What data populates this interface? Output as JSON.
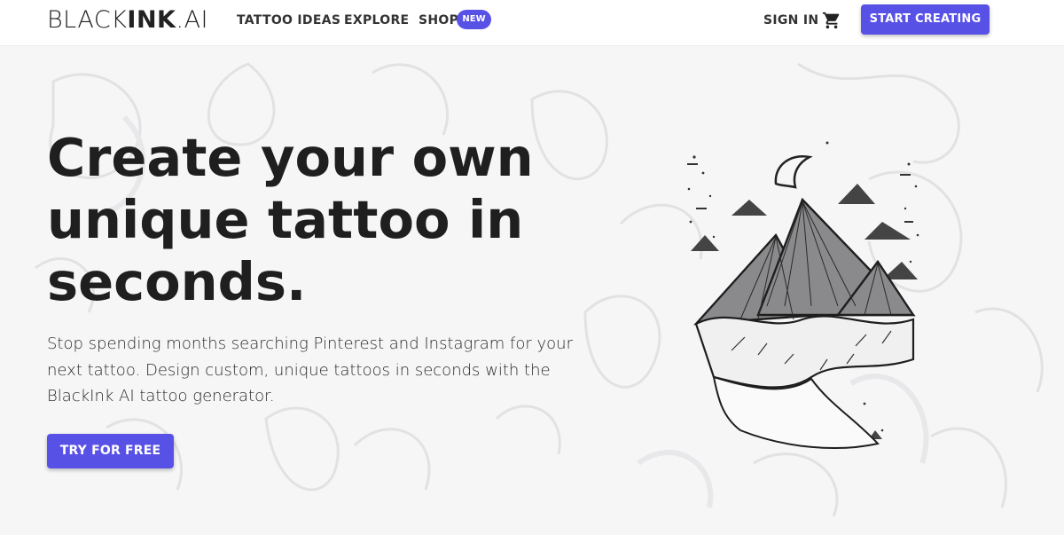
{
  "header": {
    "logo_light": "BLACK",
    "logo_bold": "INK",
    "logo_suffix": ".AI",
    "nav": [
      {
        "label": "TATTOO IDEAS"
      },
      {
        "label": "EXPLORE"
      },
      {
        "label": "SHOP"
      }
    ],
    "shop_badge": "NEW",
    "sign_in": "SIGN IN",
    "cart_icon": "cart-icon",
    "cta": "START CREATING"
  },
  "hero": {
    "headline": "Create your own unique tattoo in seconds.",
    "subtext": "Stop spending months searching Pinterest and Instagram for your next tattoo. Design custom, unique tattoos in seconds with the BlackInk AI tattoo generator.",
    "cta": "TRY FOR FREE",
    "image": "mountain-tattoo-illustration"
  },
  "colors": {
    "accent": "#5851e6",
    "background": "#f6f6f7",
    "text": "#1f1f1f"
  }
}
